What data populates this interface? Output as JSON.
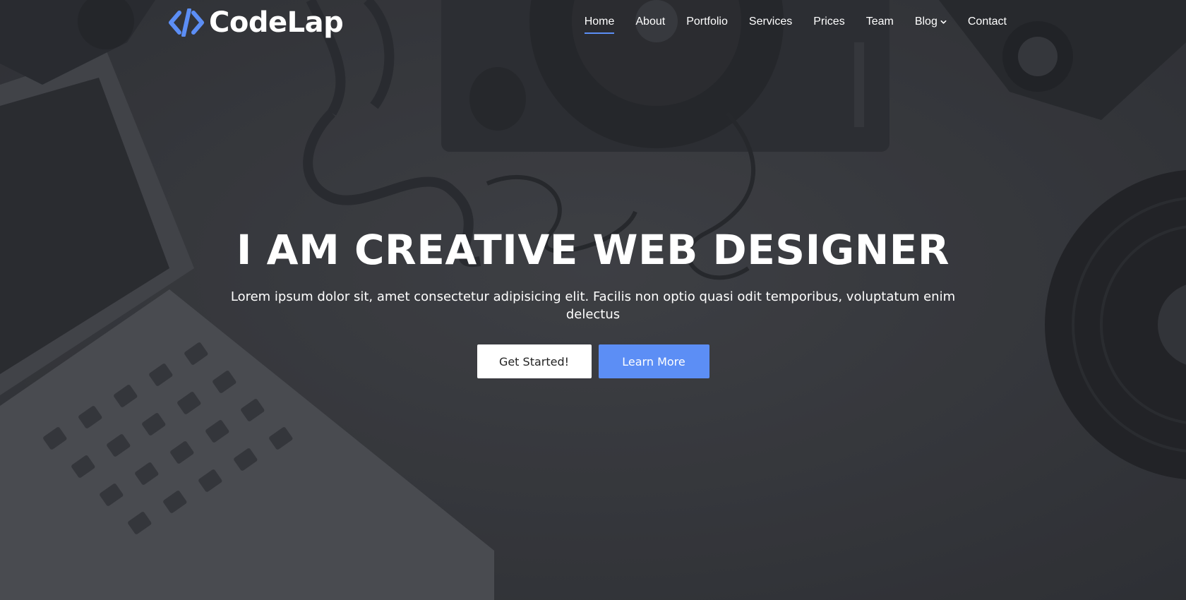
{
  "brand": {
    "name": "CodeLap",
    "icon": "code-brackets-icon",
    "accent_color": "#5c8ef5"
  },
  "nav": {
    "items": [
      {
        "label": "Home",
        "active": true
      },
      {
        "label": "About",
        "active": false
      },
      {
        "label": "Portfolio",
        "active": false
      },
      {
        "label": "Services",
        "active": false
      },
      {
        "label": "Prices",
        "active": false
      },
      {
        "label": "Team",
        "active": false
      },
      {
        "label": "Blog",
        "active": false,
        "dropdown": true
      },
      {
        "label": "Contact",
        "active": false
      }
    ],
    "dropdown_icon": "chevron-down-icon"
  },
  "hero": {
    "title": "I AM CREATIVE WEB DESIGNER",
    "subtitle": "Lorem ipsum dolor sit, amet consectetur adipisicing elit. Facilis non optio quasi odit temporibus, voluptatum enim delectus",
    "primary_button": "Get Started!",
    "secondary_button": "Learn More"
  },
  "colors": {
    "background": "#3a3b40",
    "accent": "#5c8ef5",
    "text": "#ffffff"
  }
}
